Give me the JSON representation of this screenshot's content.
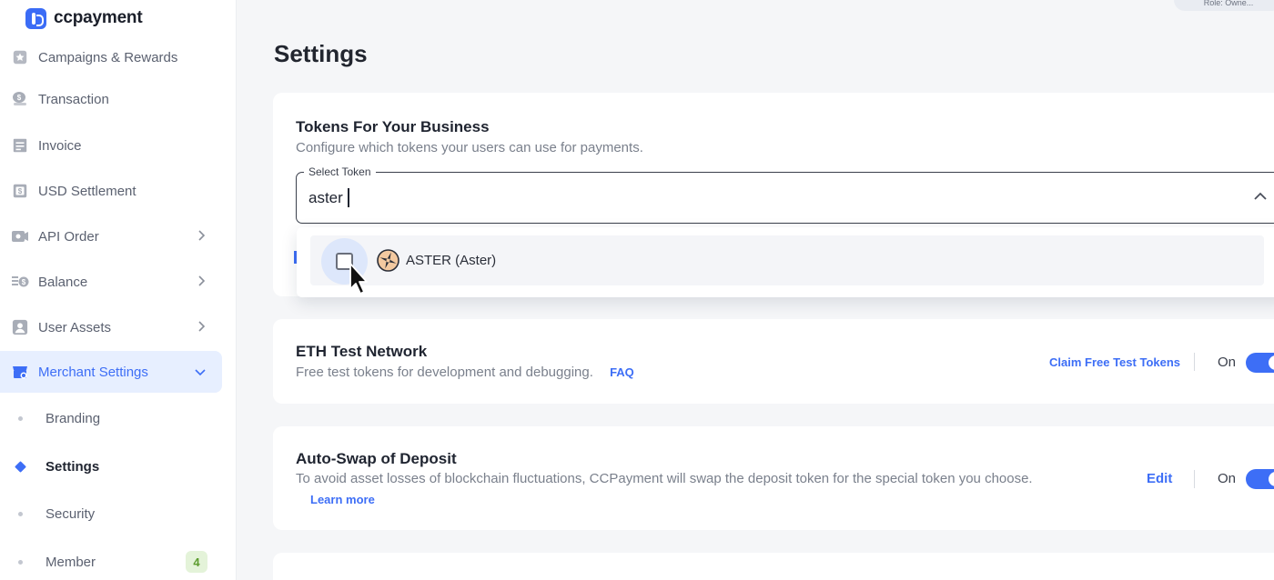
{
  "brand": {
    "name": "ccpayment",
    "accent": "#3d6ef6"
  },
  "topbar": {
    "role_text": "Role: Owne..."
  },
  "sidebar": {
    "items": [
      {
        "label": "Campaigns & Rewards",
        "icon": "star-icon",
        "has_chevron": false
      },
      {
        "label": "Transaction",
        "icon": "coins-icon",
        "has_chevron": false
      },
      {
        "label": "Invoice",
        "icon": "invoice-icon",
        "has_chevron": false
      },
      {
        "label": "USD Settlement",
        "icon": "dollar-doc-icon",
        "has_chevron": false
      },
      {
        "label": "API Order",
        "icon": "api-icon",
        "has_chevron": true
      },
      {
        "label": "Balance",
        "icon": "wallet-icon",
        "has_chevron": true
      },
      {
        "label": "User Assets",
        "icon": "user-icon",
        "has_chevron": true
      },
      {
        "label": "Merchant Settings",
        "icon": "store-gear-icon",
        "has_chevron": true,
        "active": true
      }
    ],
    "sub_items": [
      {
        "label": "Branding"
      },
      {
        "label": "Settings",
        "active": true
      },
      {
        "label": "Security"
      },
      {
        "label": "Member",
        "badge": "4"
      }
    ]
  },
  "page": {
    "title": "Settings"
  },
  "tokens_card": {
    "title": "Tokens For Your Business",
    "description": "Configure which tokens your users can use for payments.",
    "select_label": "Select Token",
    "search_value": "aster",
    "option_label": "ASTER (Aster)",
    "option_checked": false
  },
  "eth_card": {
    "title": "ETH Test Network",
    "description": "Free test tokens for development and debugging.",
    "faq_link": "FAQ",
    "claim_link": "Claim Free Test Tokens",
    "toggle_label": "On",
    "toggle_on": true
  },
  "swap_card": {
    "title": "Auto-Swap of Deposit",
    "description": "To avoid asset losses of blockchain fluctuations, CCPayment will swap the deposit token for the special token you choose.",
    "learn_more": "Learn more",
    "edit_link": "Edit",
    "toggle_label": "On",
    "toggle_on": true
  }
}
